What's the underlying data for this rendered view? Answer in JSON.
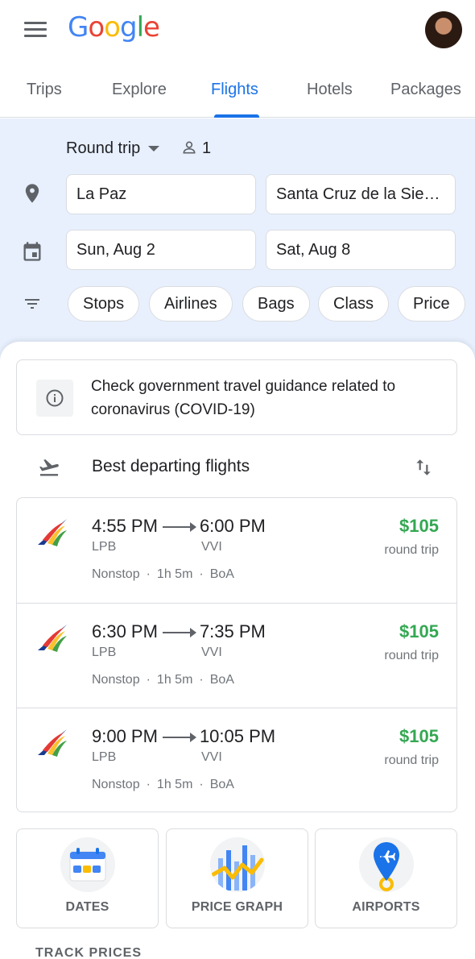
{
  "header": {
    "logo_text": "Google",
    "logo_colors": [
      "#4285F4",
      "#EA4335",
      "#FBBC05",
      "#4285F4",
      "#34A853",
      "#EA4335"
    ]
  },
  "tabs": [
    {
      "label": "Trips"
    },
    {
      "label": "Explore"
    },
    {
      "label": "Flights",
      "active": true
    },
    {
      "label": "Hotels"
    },
    {
      "label": "Packages"
    }
  ],
  "search": {
    "trip_type": "Round trip",
    "passengers": "1",
    "origin": "La Paz",
    "destination": "Santa Cruz de la Sierr…",
    "depart_date": "Sun, Aug 2",
    "return_date": "Sat, Aug 8",
    "filters": [
      "Stops",
      "Airlines",
      "Bags",
      "Class",
      "Price"
    ]
  },
  "notice": {
    "text": "Check government travel guidance related to coronavirus (COVID-19)"
  },
  "results": {
    "title": "Best departing flights",
    "flights": [
      {
        "depart_time": "4:55 PM",
        "arrive_time": "6:00 PM",
        "depart_code": "LPB",
        "arrive_code": "VVI",
        "stops": "Nonstop",
        "duration": "1h 5m",
        "airline": "BoA",
        "price": "$105",
        "price_note": "round trip"
      },
      {
        "depart_time": "6:30 PM",
        "arrive_time": "7:35 PM",
        "depart_code": "LPB",
        "arrive_code": "VVI",
        "stops": "Nonstop",
        "duration": "1h 5m",
        "airline": "BoA",
        "price": "$105",
        "price_note": "round trip"
      },
      {
        "depart_time": "9:00 PM",
        "arrive_time": "10:05 PM",
        "depart_code": "LPB",
        "arrive_code": "VVI",
        "stops": "Nonstop",
        "duration": "1h 5m",
        "airline": "BoA",
        "price": "$105",
        "price_note": "round trip"
      }
    ]
  },
  "tools": [
    {
      "label": "DATES"
    },
    {
      "label": "PRICE GRAPH"
    },
    {
      "label": "AIRPORTS"
    }
  ],
  "track_prices": "TRACK PRICES",
  "colors": {
    "accent": "#1a73e8",
    "price": "#34a853",
    "panel": "#e8f0fe"
  }
}
